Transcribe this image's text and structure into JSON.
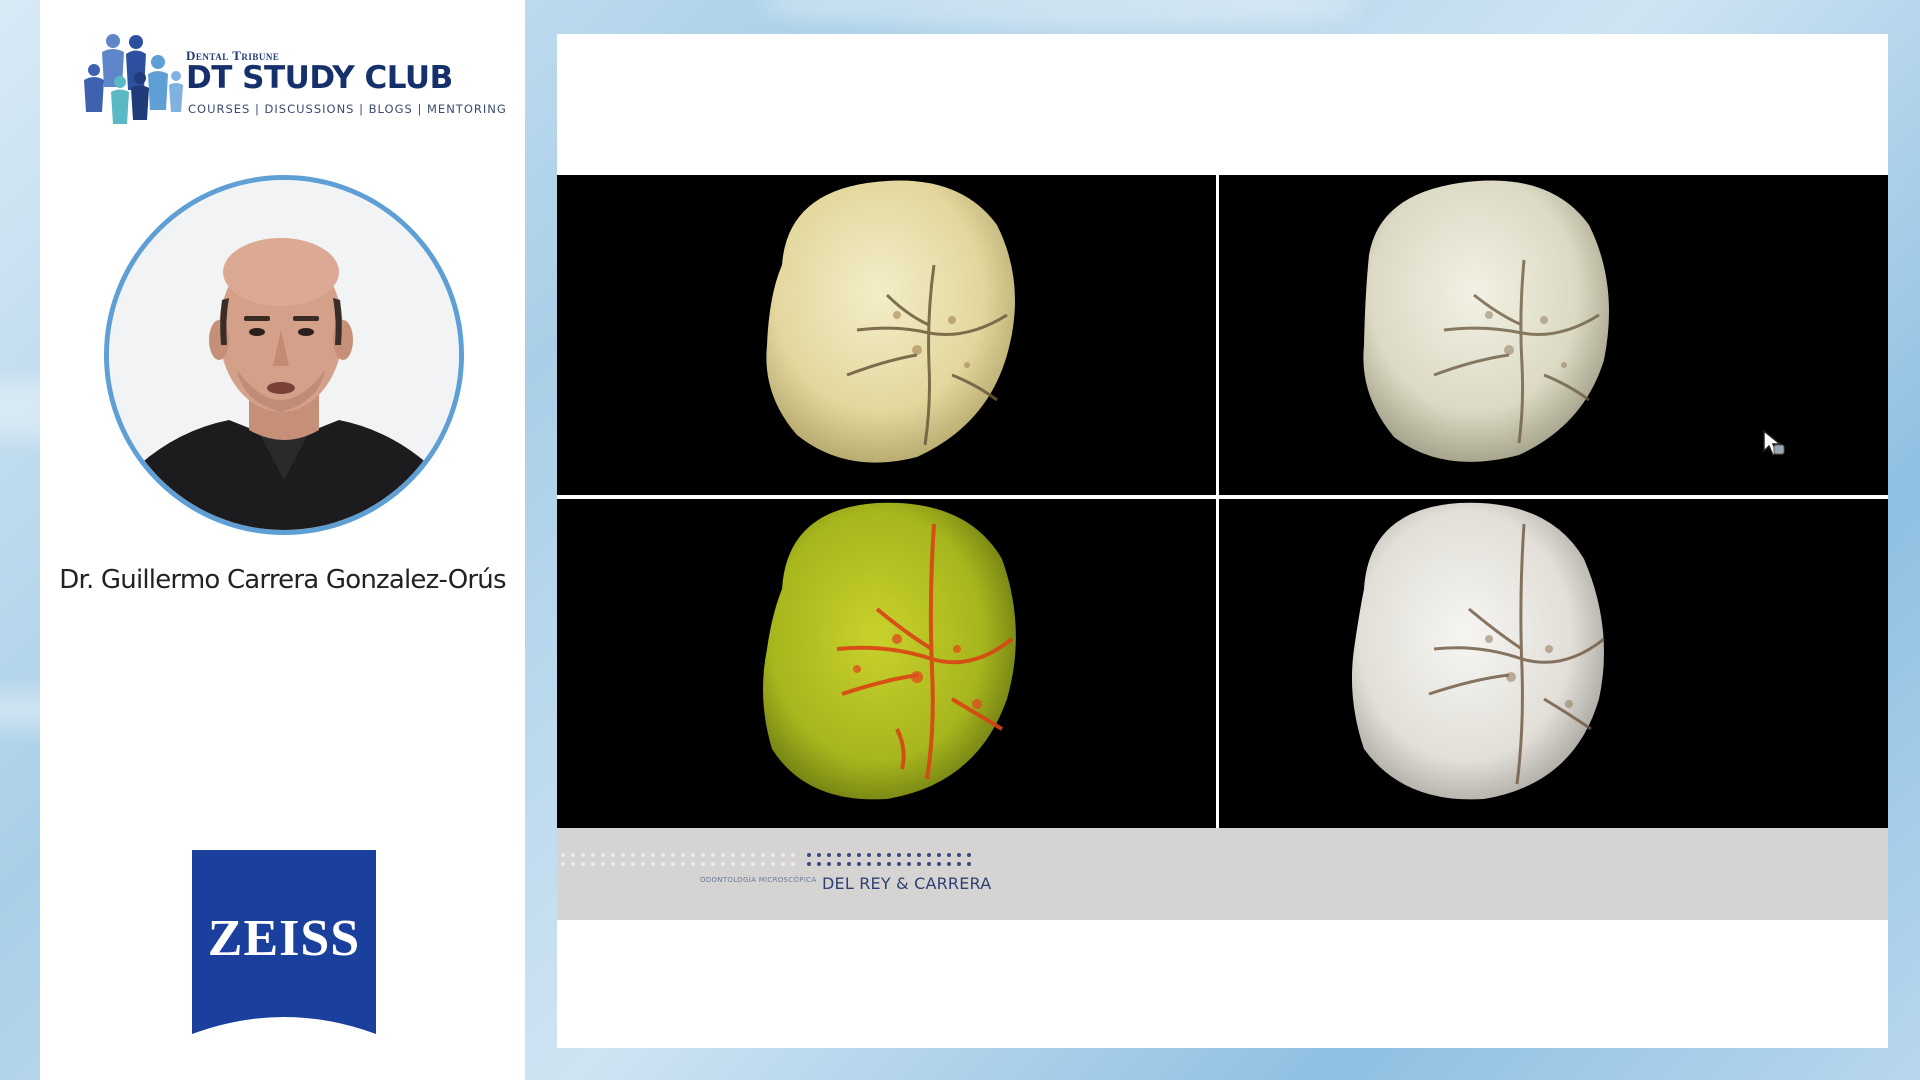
{
  "branding": {
    "publisher": "Dental Tribune",
    "title": "DT STUDY CLUB",
    "nav": "COURSES | DISCUSSIONS | BLOGS | MENTORING",
    "colors": {
      "navy": "#16306b",
      "lightBlue": "#5e9fd6",
      "teal": "#5bb8c5"
    }
  },
  "speaker": {
    "name": "Dr. Guillermo Carrera Gonzalez-Orús",
    "avatar_icon": "speaker-video-avatar"
  },
  "sponsor": {
    "name": "ZEISS",
    "color": "#1a3f9c"
  },
  "slide": {
    "images": [
      {
        "label": "tooth-occlusal-view-natural-light",
        "tone": "#e6deb0"
      },
      {
        "label": "tooth-occlusal-view-neutral-light",
        "tone": "#e4e2cc"
      },
      {
        "label": "tooth-occlusal-view-fluorescence",
        "tone": "#b7c225"
      },
      {
        "label": "tooth-occlusal-view-white-light",
        "tone": "#e8e6e0"
      }
    ],
    "footer": {
      "small_text": "ODONTOLOGÍA MICROSCÓPICA",
      "brand": "DEL REY & CARRERA"
    }
  },
  "cursor": {
    "icon": "mouse-pointer-icon"
  }
}
